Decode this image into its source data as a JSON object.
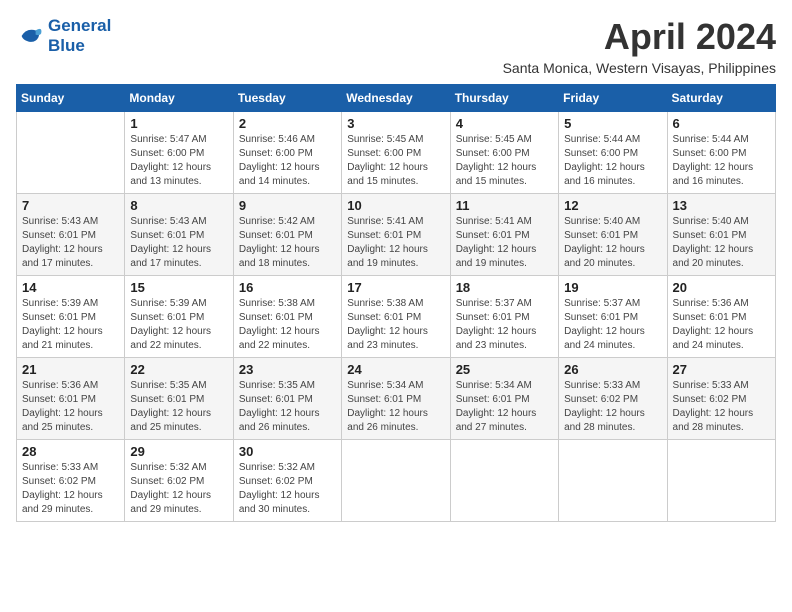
{
  "logo": {
    "line1": "General",
    "line2": "Blue"
  },
  "title": "April 2024",
  "location": "Santa Monica, Western Visayas, Philippines",
  "headers": [
    "Sunday",
    "Monday",
    "Tuesday",
    "Wednesday",
    "Thursday",
    "Friday",
    "Saturday"
  ],
  "weeks": [
    [
      {
        "day": "",
        "info": ""
      },
      {
        "day": "1",
        "info": "Sunrise: 5:47 AM\nSunset: 6:00 PM\nDaylight: 12 hours\nand 13 minutes."
      },
      {
        "day": "2",
        "info": "Sunrise: 5:46 AM\nSunset: 6:00 PM\nDaylight: 12 hours\nand 14 minutes."
      },
      {
        "day": "3",
        "info": "Sunrise: 5:45 AM\nSunset: 6:00 PM\nDaylight: 12 hours\nand 15 minutes."
      },
      {
        "day": "4",
        "info": "Sunrise: 5:45 AM\nSunset: 6:00 PM\nDaylight: 12 hours\nand 15 minutes."
      },
      {
        "day": "5",
        "info": "Sunrise: 5:44 AM\nSunset: 6:00 PM\nDaylight: 12 hours\nand 16 minutes."
      },
      {
        "day": "6",
        "info": "Sunrise: 5:44 AM\nSunset: 6:00 PM\nDaylight: 12 hours\nand 16 minutes."
      }
    ],
    [
      {
        "day": "7",
        "info": "Sunrise: 5:43 AM\nSunset: 6:01 PM\nDaylight: 12 hours\nand 17 minutes."
      },
      {
        "day": "8",
        "info": "Sunrise: 5:43 AM\nSunset: 6:01 PM\nDaylight: 12 hours\nand 17 minutes."
      },
      {
        "day": "9",
        "info": "Sunrise: 5:42 AM\nSunset: 6:01 PM\nDaylight: 12 hours\nand 18 minutes."
      },
      {
        "day": "10",
        "info": "Sunrise: 5:41 AM\nSunset: 6:01 PM\nDaylight: 12 hours\nand 19 minutes."
      },
      {
        "day": "11",
        "info": "Sunrise: 5:41 AM\nSunset: 6:01 PM\nDaylight: 12 hours\nand 19 minutes."
      },
      {
        "day": "12",
        "info": "Sunrise: 5:40 AM\nSunset: 6:01 PM\nDaylight: 12 hours\nand 20 minutes."
      },
      {
        "day": "13",
        "info": "Sunrise: 5:40 AM\nSunset: 6:01 PM\nDaylight: 12 hours\nand 20 minutes."
      }
    ],
    [
      {
        "day": "14",
        "info": "Sunrise: 5:39 AM\nSunset: 6:01 PM\nDaylight: 12 hours\nand 21 minutes."
      },
      {
        "day": "15",
        "info": "Sunrise: 5:39 AM\nSunset: 6:01 PM\nDaylight: 12 hours\nand 22 minutes."
      },
      {
        "day": "16",
        "info": "Sunrise: 5:38 AM\nSunset: 6:01 PM\nDaylight: 12 hours\nand 22 minutes."
      },
      {
        "day": "17",
        "info": "Sunrise: 5:38 AM\nSunset: 6:01 PM\nDaylight: 12 hours\nand 23 minutes."
      },
      {
        "day": "18",
        "info": "Sunrise: 5:37 AM\nSunset: 6:01 PM\nDaylight: 12 hours\nand 23 minutes."
      },
      {
        "day": "19",
        "info": "Sunrise: 5:37 AM\nSunset: 6:01 PM\nDaylight: 12 hours\nand 24 minutes."
      },
      {
        "day": "20",
        "info": "Sunrise: 5:36 AM\nSunset: 6:01 PM\nDaylight: 12 hours\nand 24 minutes."
      }
    ],
    [
      {
        "day": "21",
        "info": "Sunrise: 5:36 AM\nSunset: 6:01 PM\nDaylight: 12 hours\nand 25 minutes."
      },
      {
        "day": "22",
        "info": "Sunrise: 5:35 AM\nSunset: 6:01 PM\nDaylight: 12 hours\nand 25 minutes."
      },
      {
        "day": "23",
        "info": "Sunrise: 5:35 AM\nSunset: 6:01 PM\nDaylight: 12 hours\nand 26 minutes."
      },
      {
        "day": "24",
        "info": "Sunrise: 5:34 AM\nSunset: 6:01 PM\nDaylight: 12 hours\nand 26 minutes."
      },
      {
        "day": "25",
        "info": "Sunrise: 5:34 AM\nSunset: 6:01 PM\nDaylight: 12 hours\nand 27 minutes."
      },
      {
        "day": "26",
        "info": "Sunrise: 5:33 AM\nSunset: 6:02 PM\nDaylight: 12 hours\nand 28 minutes."
      },
      {
        "day": "27",
        "info": "Sunrise: 5:33 AM\nSunset: 6:02 PM\nDaylight: 12 hours\nand 28 minutes."
      }
    ],
    [
      {
        "day": "28",
        "info": "Sunrise: 5:33 AM\nSunset: 6:02 PM\nDaylight: 12 hours\nand 29 minutes."
      },
      {
        "day": "29",
        "info": "Sunrise: 5:32 AM\nSunset: 6:02 PM\nDaylight: 12 hours\nand 29 minutes."
      },
      {
        "day": "30",
        "info": "Sunrise: 5:32 AM\nSunset: 6:02 PM\nDaylight: 12 hours\nand 30 minutes."
      },
      {
        "day": "",
        "info": ""
      },
      {
        "day": "",
        "info": ""
      },
      {
        "day": "",
        "info": ""
      },
      {
        "day": "",
        "info": ""
      }
    ]
  ]
}
